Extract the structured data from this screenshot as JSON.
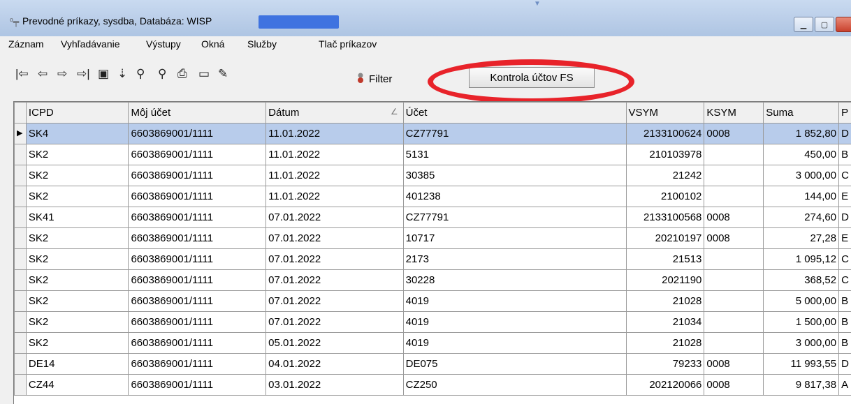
{
  "window": {
    "title": "Prevodné príkazy, sysdba, Databáza: WISP",
    "icon": "transfer-icon"
  },
  "menu": [
    "Záznam",
    "Vyhľadávanie",
    "Výstupy",
    "Okná",
    "Služby",
    "Tlač príkazov"
  ],
  "toolbar": {
    "filter_label": "Filter",
    "kontrola_label": "Kontrola účtov FS",
    "highlight_color": "#e8232a"
  },
  "grid": {
    "columns": [
      "ICPD",
      "Môj účet",
      "Dátum",
      "Účet",
      "VSYM",
      "KSYM",
      "Suma",
      "P"
    ],
    "sorted_column": "Dátum",
    "selected_row": 0,
    "rows": [
      [
        "SK4",
        "6603869001/1111",
        "11.01.2022",
        "CZ77791",
        "2133100624",
        "0008",
        "1 852,80",
        "D"
      ],
      [
        "SK2",
        "6603869001/1111",
        "11.01.2022",
        "5131",
        "210103978",
        "",
        "450,00",
        "B"
      ],
      [
        "SK2",
        "6603869001/1111",
        "11.01.2022",
        "30385",
        "21242",
        "",
        "3 000,00",
        "C"
      ],
      [
        "SK2",
        "6603869001/1111",
        "11.01.2022",
        "401238",
        "2100102",
        "",
        "144,00",
        "E"
      ],
      [
        "SK41",
        "6603869001/1111",
        "07.01.2022",
        "CZ77791",
        "2133100568",
        "0008",
        "274,60",
        "D"
      ],
      [
        "SK2",
        "6603869001/1111",
        "07.01.2022",
        "10717",
        "20210197",
        "0008",
        "27,28",
        "E"
      ],
      [
        "SK2",
        "6603869001/1111",
        "07.01.2022",
        "2173",
        "21513",
        "",
        "1 095,12",
        "C"
      ],
      [
        "SK2",
        "6603869001/1111",
        "07.01.2022",
        "30228",
        "2021190",
        "",
        "368,52",
        "C"
      ],
      [
        "SK2",
        "6603869001/1111",
        "07.01.2022",
        "4019",
        "21028",
        "",
        "5 000,00",
        "B"
      ],
      [
        "SK2",
        "6603869001/1111",
        "07.01.2022",
        "4019",
        "21034",
        "",
        "1 500,00",
        "B"
      ],
      [
        "SK2",
        "6603869001/1111",
        "05.01.2022",
        "4019",
        "21028",
        "",
        "3 000,00",
        "B"
      ],
      [
        "DE14",
        "6603869001/1111",
        "04.01.2022",
        "DE075",
        "79233",
        "0008",
        "11 993,55",
        "D"
      ],
      [
        "CZ44",
        "6603869001/1111",
        "03.01.2022",
        "CZ250",
        "202120066",
        "0008",
        "9 817,38",
        "A"
      ]
    ]
  }
}
